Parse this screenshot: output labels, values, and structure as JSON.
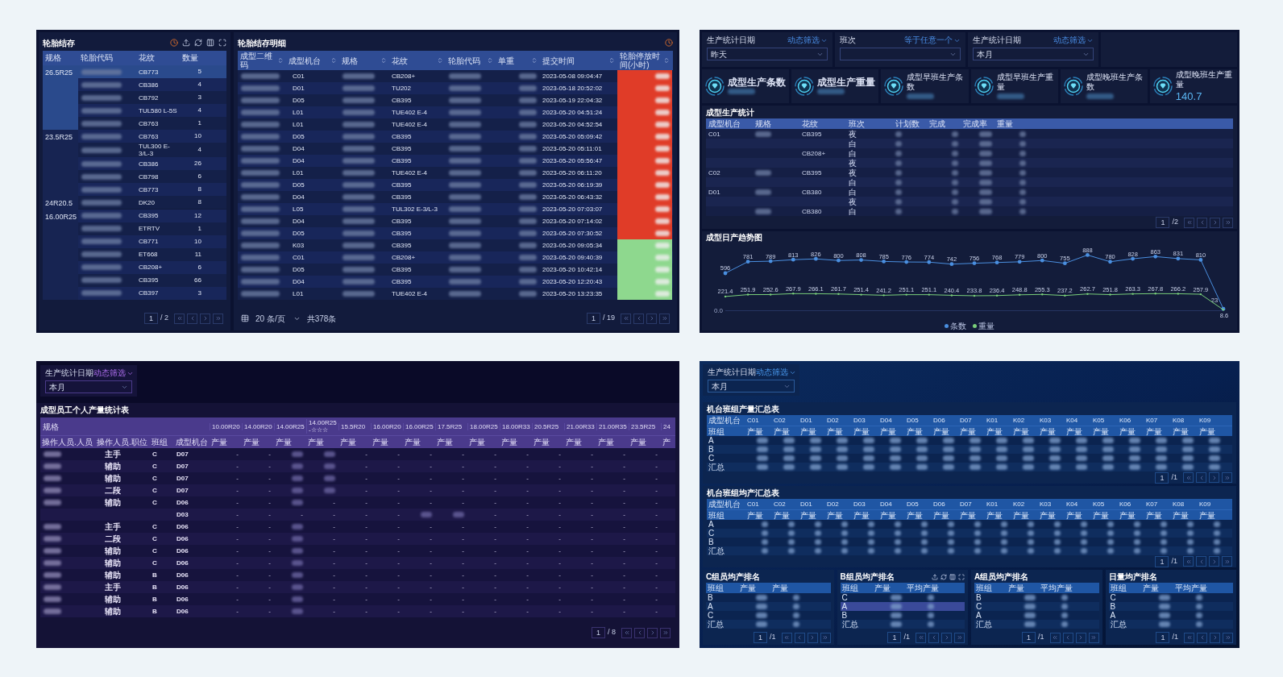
{
  "inventory": {
    "title": "轮胎结存",
    "columns": [
      "规格",
      "轮胎代码",
      "花纹",
      "数量"
    ],
    "groups": [
      {
        "spec": "26.5R25",
        "selected": true,
        "rows": [
          {
            "pattern": "CB773",
            "qty": "5",
            "selected": true
          },
          {
            "pattern": "CB386",
            "qty": "4",
            "selected": false
          },
          {
            "pattern": "CB792",
            "qty": "3",
            "selected": false
          },
          {
            "pattern": "TUL580 L-5S",
            "qty": "4",
            "selected": false
          },
          {
            "pattern": "CB763",
            "qty": "1",
            "selected": false
          }
        ]
      },
      {
        "spec": "23.5R25",
        "selected": false,
        "rows": [
          {
            "pattern": "CB763",
            "qty": "10",
            "selected": false
          },
          {
            "pattern": "TUL300 E-3/L-3",
            "qty": "4",
            "selected": false
          },
          {
            "pattern": "CB386",
            "qty": "26",
            "selected": false
          },
          {
            "pattern": "CB798",
            "qty": "6",
            "selected": false
          },
          {
            "pattern": "CB773",
            "qty": "8",
            "selected": false
          }
        ]
      },
      {
        "spec": "24R20.5",
        "selected": false,
        "rows": [
          {
            "pattern": "DK20",
            "qty": "8",
            "selected": false
          }
        ]
      },
      {
        "spec": "16.00R25",
        "selected": false,
        "rows": [
          {
            "pattern": "CB395",
            "qty": "12",
            "selected": false
          },
          {
            "pattern": "ETRTV",
            "qty": "1",
            "selected": false
          },
          {
            "pattern": "CB771",
            "qty": "10",
            "selected": false
          },
          {
            "pattern": "ET668",
            "qty": "11",
            "selected": false
          },
          {
            "pattern": "CB208+",
            "qty": "6",
            "selected": false
          },
          {
            "pattern": "CB395",
            "qty": "66",
            "selected": false
          },
          {
            "pattern": "CB397",
            "qty": "3",
            "selected": false
          }
        ]
      }
    ],
    "pager": {
      "page": "1",
      "total": "/ 2"
    }
  },
  "inventory_detail": {
    "title": "轮胎结存明细",
    "columns": [
      "成型二维码",
      "成型机台",
      "规格",
      "花纹",
      "轮胎代码",
      "单重",
      "提交时间",
      "轮胎停放时间(小时)"
    ],
    "rows": [
      {
        "machine": "C01",
        "pattern": "CB208+",
        "time": "2023-05-08 09:04:47",
        "color": "#e03c28"
      },
      {
        "machine": "D01",
        "pattern": "TU202",
        "time": "2023-05-18 20:52:02",
        "color": "#e03c28"
      },
      {
        "machine": "D05",
        "pattern": "CB395",
        "time": "2023-05-19 22:04:32",
        "color": "#e03c28"
      },
      {
        "machine": "L01",
        "pattern": "TUE402 E-4",
        "time": "2023-05-20 04:51:24",
        "color": "#e03c28"
      },
      {
        "machine": "L01",
        "pattern": "TUE402 E-4",
        "time": "2023-05-20 04:52:54",
        "color": "#e03c28"
      },
      {
        "machine": "D05",
        "pattern": "CB395",
        "time": "2023-05-20 05:09:42",
        "color": "#e03c28"
      },
      {
        "machine": "D04",
        "pattern": "CB395",
        "time": "2023-05-20 05:11:01",
        "color": "#e03c28"
      },
      {
        "machine": "D04",
        "pattern": "CB395",
        "time": "2023-05-20 05:56:47",
        "color": "#e03c28"
      },
      {
        "machine": "L01",
        "pattern": "TUE402 E-4",
        "time": "2023-05-20 06:11:20",
        "color": "#e03c28"
      },
      {
        "machine": "D05",
        "pattern": "CB395",
        "time": "2023-05-20 06:19:39",
        "color": "#e03c28"
      },
      {
        "machine": "D04",
        "pattern": "CB395",
        "time": "2023-05-20 06:43:32",
        "color": "#e03c28"
      },
      {
        "machine": "L05",
        "pattern": "TUL302 E-3/L-3",
        "time": "2023-05-20 07:03:07",
        "color": "#e03c28"
      },
      {
        "machine": "D04",
        "pattern": "CB395",
        "time": "2023-05-20 07:14:02",
        "color": "#e03c28"
      },
      {
        "machine": "D05",
        "pattern": "CB395",
        "time": "2023-05-20 07:30:52",
        "color": "#e03c28"
      },
      {
        "machine": "K03",
        "pattern": "CB395",
        "time": "2023-05-20 09:05:34",
        "color": "#8ed88e"
      },
      {
        "machine": "C01",
        "pattern": "CB208+",
        "time": "2023-05-20 09:40:39",
        "color": "#8ed88e"
      },
      {
        "machine": "D05",
        "pattern": "CB395",
        "time": "2023-05-20 10:42:14",
        "color": "#8ed88e"
      },
      {
        "machine": "D04",
        "pattern": "CB395",
        "time": "2023-05-20 12:20:43",
        "color": "#8ed88e"
      },
      {
        "machine": "L01",
        "pattern": "TUE402 E-4",
        "time": "2023-05-20 13:23:35",
        "color": "#8ed88e"
      }
    ],
    "pager": {
      "page_size": "20 条/页",
      "count": "共378条",
      "page": "1",
      "total": "/ 19"
    }
  },
  "production": {
    "filters": [
      {
        "label": "生产统计日期",
        "mode": "动态筛选",
        "value": "昨天"
      },
      {
        "label": "班次",
        "mode": "等于任意一个"
      },
      {
        "label": "生产统计日期",
        "mode": "动态筛选",
        "value": "本月"
      }
    ],
    "kpis": [
      {
        "title": "成型生产条数",
        "emphasis": true
      },
      {
        "title": "成型生产重量",
        "emphasis": true
      },
      {
        "title": "成型早班生产条数",
        "emphasis": false
      },
      {
        "title": "成型早班生产重量",
        "emphasis": false
      },
      {
        "title": "成型晚班生产条数",
        "emphasis": false
      },
      {
        "title": "成型晚班生产重量",
        "emphasis": false,
        "value": "140.7"
      }
    ],
    "table": {
      "title": "成型生产统计",
      "columns": [
        "成型机台",
        "规格",
        "花纹",
        "班次",
        "计划数",
        "完成",
        "完成率",
        "重量"
      ],
      "rows": [
        {
          "machine": "C01",
          "spec_redacted": true,
          "pattern": "CB395",
          "shift": "夜"
        },
        {
          "spec_redacted": false,
          "shift": "白"
        },
        {
          "spec_redacted": false,
          "pattern": "CB208+",
          "shift": "白"
        },
        {
          "spec_redacted": false,
          "shift": "夜"
        },
        {
          "machine": "C02",
          "spec_redacted": true,
          "pattern": "CB395",
          "shift": "夜"
        },
        {
          "spec_redacted": false,
          "shift": "白"
        },
        {
          "machine": "D01",
          "spec_redacted": true,
          "pattern": "CB380",
          "shift": "白"
        },
        {
          "spec_redacted": false,
          "shift": "夜"
        },
        {
          "spec_redacted": true,
          "pattern": "CB380",
          "shift": "白"
        }
      ],
      "pager": {
        "page": "1",
        "total": "/2"
      }
    },
    "trend": {
      "title": "成型日产趋势图",
      "chart_data": {
        "type": "line",
        "legend": "bottom",
        "annotations": [
          {
            "text": "0.0"
          }
        ],
        "data_labels": true,
        "series": [
          {
            "name": "条数",
            "color": "#4a8fe0",
            "values": [
              596,
              781,
              789,
              813,
              826,
              800,
              808,
              785,
              776,
              774,
              742,
              756,
              768,
              779,
              800,
              755,
              888,
              780,
              828,
              863,
              831,
              810,
              23
            ]
          },
          {
            "name": "重量",
            "color": "#7ad07a",
            "values": [
              221.4,
              251.9,
              252.6,
              267.9,
              266.1,
              261.7,
              251.4,
              241.2,
              251.1,
              251.1,
              240.4,
              233.8,
              236.4,
              248.8,
              255.3,
              237.2,
              262.7,
              251.8,
              263.3,
              267.8,
              266.2,
              257.9,
              8.6
            ]
          }
        ]
      }
    }
  },
  "staff": {
    "filter": {
      "label": "生产统计日期",
      "mode": "动态筛选",
      "value": "本月"
    },
    "title": "成型员工个人产量统计表",
    "group_header": "规格",
    "sizes": [
      "10.00R20",
      "14.00R20",
      "14.00R25",
      "14.00R25-☆☆☆",
      "15.5R20",
      "16.00R20",
      "16.00R25",
      "17.5R25",
      "18.00R25",
      "18.00R33",
      "20.5R25",
      "21.00R33",
      "21.00R35",
      "23.5R25",
      "24"
    ],
    "columns": [
      "操作人员.人员",
      "操作人员.职位",
      "班组",
      "成型机台"
    ],
    "units": [
      "产量",
      "产量",
      "产量",
      "产量",
      "产量",
      "产量",
      "产量",
      "产量",
      "产量",
      "产量",
      "产量",
      "产量",
      "产量",
      "产量",
      "产"
    ],
    "rows": [
      {
        "name_redacted": true,
        "position": "主手",
        "team": "C",
        "machine": "D07",
        "cells": [
          "-",
          "-",
          {
            "kind": "redacted"
          },
          {
            "kind": "redacted"
          },
          "-",
          "-",
          "-",
          "-",
          "-",
          "-",
          "-",
          "-",
          "-",
          "-"
        ]
      },
      {
        "name_redacted": true,
        "position": "辅助",
        "team": "C",
        "machine": "D07",
        "cells": [
          "-",
          "-",
          {
            "kind": "redacted"
          },
          {
            "kind": "redacted"
          },
          "-",
          "-",
          "-",
          "-",
          "-",
          "-",
          "-",
          "-",
          "-",
          "-"
        ]
      },
      {
        "name_redacted": true,
        "position": "辅助",
        "team": "C",
        "machine": "D07",
        "cells": [
          "-",
          "-",
          {
            "kind": "redacted"
          },
          {
            "kind": "redacted"
          },
          "-",
          "-",
          "-",
          "-",
          "-",
          "-",
          "-",
          "-",
          "-",
          "-"
        ]
      },
      {
        "name_redacted": true,
        "position": "二段",
        "team": "C",
        "machine": "D07",
        "cells": [
          "-",
          "-",
          {
            "kind": "redacted"
          },
          {
            "kind": "redacted"
          },
          "-",
          "-",
          "-",
          "-",
          "-",
          "-",
          "-",
          "-",
          "-",
          "-"
        ]
      },
      {
        "name_redacted": true,
        "position": "辅助",
        "team": "C",
        "machine": "D06",
        "cells": [
          "-",
          "-",
          {
            "kind": "redacted"
          },
          "-",
          "-",
          "-",
          "-",
          "-",
          "-",
          "-",
          "-",
          "-",
          "-",
          "-"
        ]
      },
      {
        "name_redacted": false,
        "machine": "D03",
        "cells": [
          "-",
          "-",
          "-",
          "-",
          "-",
          "-",
          {
            "kind": "redacted"
          },
          {
            "kind": "redacted"
          },
          "-",
          "-",
          "-",
          "-",
          "-",
          "-"
        ]
      },
      {
        "name_redacted": true,
        "position": "主手",
        "team": "C",
        "machine": "D06",
        "cells": [
          "-",
          "-",
          {
            "kind": "redacted"
          },
          "-",
          "-",
          "-",
          "-",
          "-",
          "-",
          "-",
          "-",
          "-",
          "-",
          "-"
        ]
      },
      {
        "name_redacted": true,
        "position": "二段",
        "team": "C",
        "machine": "D06",
        "cells": [
          "-",
          "-",
          {
            "kind": "redacted"
          },
          "-",
          "-",
          "-",
          "-",
          "-",
          "-",
          "-",
          "-",
          "-",
          "-",
          "-"
        ]
      },
      {
        "name_redacted": true,
        "position": "辅助",
        "team": "C",
        "machine": "D06",
        "cells": [
          "-",
          "-",
          {
            "kind": "redacted"
          },
          "-",
          "-",
          "-",
          "-",
          "-",
          "-",
          "-",
          "-",
          "-",
          "-",
          "-"
        ]
      },
      {
        "name_redacted": true,
        "position": "辅助",
        "team": "C",
        "machine": "D06",
        "cells": [
          "-",
          "-",
          {
            "kind": "redacted"
          },
          "-",
          "-",
          "-",
          "-",
          "-",
          "-",
          "-",
          "-",
          "-",
          "-",
          "-"
        ]
      },
      {
        "name_redacted": true,
        "position": "辅助",
        "team": "B",
        "machine": "D06",
        "cells": [
          "-",
          "-",
          {
            "kind": "redacted"
          },
          "-",
          "-",
          "-",
          "-",
          "-",
          "-",
          "-",
          "-",
          "-",
          "-",
          "-"
        ]
      },
      {
        "name_redacted": true,
        "position": "主手",
        "team": "B",
        "machine": "D06",
        "cells": [
          "-",
          "-",
          {
            "kind": "redacted"
          },
          "-",
          "-",
          "-",
          "-",
          "-",
          "-",
          "-",
          "-",
          "-",
          "-",
          "-"
        ]
      },
      {
        "name_redacted": true,
        "position": "辅助",
        "team": "B",
        "machine": "D06",
        "cells": [
          "-",
          "-",
          {
            "kind": "redacted"
          },
          "-",
          "-",
          "-",
          "-",
          "-",
          "-",
          "-",
          "-",
          "-",
          "-",
          "-"
        ]
      },
      {
        "name_redacted": true,
        "position": "辅助",
        "team": "B",
        "machine": "D06",
        "cells": [
          "-",
          "-",
          {
            "kind": "redacted"
          },
          "-",
          "-",
          "-",
          "-",
          "-",
          "-",
          "-",
          "-",
          "-",
          "-",
          "-"
        ]
      }
    ],
    "pager": {
      "page": "1",
      "total": "/ 8"
    }
  },
  "team_output": {
    "filter": {
      "label": "生产统计日期",
      "mode": "动态筛选",
      "value": "本月"
    },
    "tables": [
      {
        "title": "机台班组产量汇总表",
        "corner": [
          "成型机台",
          "班组"
        ],
        "machines": [
          "C01",
          "C02",
          "D01",
          "D02",
          "D03",
          "D04",
          "D05",
          "D06",
          "D07",
          "K01",
          "K02",
          "K03",
          "K04",
          "K05",
          "K06",
          "K07",
          "K08",
          "K09"
        ],
        "units": [
          "产量",
          "产量",
          "产量",
          "产量",
          "产量",
          "产量",
          "产量",
          "产量",
          "产量",
          "产量",
          "产量",
          "产量",
          "产量",
          "产量",
          "产量",
          "产量",
          "产量",
          "产量"
        ],
        "teams": [
          "A",
          "B",
          "C",
          "汇总"
        ],
        "pager": {
          "page": "1",
          "total": "/1"
        }
      },
      {
        "title": "机台班组均产汇总表",
        "corner": [
          "成型机台",
          "班组"
        ],
        "machines": [
          "C01",
          "C02",
          "D01",
          "D02",
          "D03",
          "D04",
          "D05",
          "D06",
          "D07",
          "K01",
          "K02",
          "K03",
          "K04",
          "K05",
          "K06",
          "K07",
          "K08",
          "K09"
        ],
        "units": [
          "产量",
          "产量",
          "产量",
          "产量",
          "产量",
          "产量",
          "产量",
          "产量",
          "产量",
          "产量",
          "产量",
          "产量",
          "产量",
          "产量",
          "产量",
          "产量",
          "产量",
          "产量"
        ],
        "teams": [
          "A",
          "C",
          "B",
          "汇总"
        ],
        "pager": {
          "page": "1",
          "total": "/1"
        }
      }
    ],
    "rankings": [
      {
        "title": "C组员均产排名",
        "columns": [
          "班组",
          "产量",
          "产量"
        ],
        "rows": [
          {
            "team": "B",
            "selected": false
          },
          {
            "team": "A",
            "selected": false
          },
          {
            "team": "C",
            "selected": false
          },
          {
            "team": "汇总",
            "selected": false
          }
        ],
        "pager": {
          "page": "1",
          "total": "/1"
        }
      },
      {
        "title": "B组员均产排名",
        "columns": [
          "班组",
          "产量",
          "平均产量"
        ],
        "rows": [
          {
            "team": "C",
            "selected": false
          },
          {
            "team": "A",
            "selected": true
          },
          {
            "team": "B",
            "selected": false
          },
          {
            "team": "汇总",
            "selected": false
          }
        ],
        "pager": {
          "page": "1",
          "total": "/1"
        }
      },
      {
        "title": "A组员均产排名",
        "columns": [
          "班组",
          "产量",
          "平均产量"
        ],
        "rows": [
          {
            "team": "B",
            "selected": false
          },
          {
            "team": "C",
            "selected": false
          },
          {
            "team": "A",
            "selected": false
          },
          {
            "team": "汇总",
            "selected": false
          }
        ],
        "pager": {
          "page": "1",
          "total": "/1"
        }
      },
      {
        "title": "日量均产排名",
        "columns": [
          "班组",
          "产量",
          "平均产量"
        ],
        "rows": [
          {
            "team": "C",
            "selected": false
          },
          {
            "team": "B",
            "selected": false
          },
          {
            "team": "A",
            "selected": false
          },
          {
            "team": "汇总",
            "selected": false
          }
        ],
        "pager": {
          "page": "1",
          "total": "/1"
        }
      }
    ]
  }
}
